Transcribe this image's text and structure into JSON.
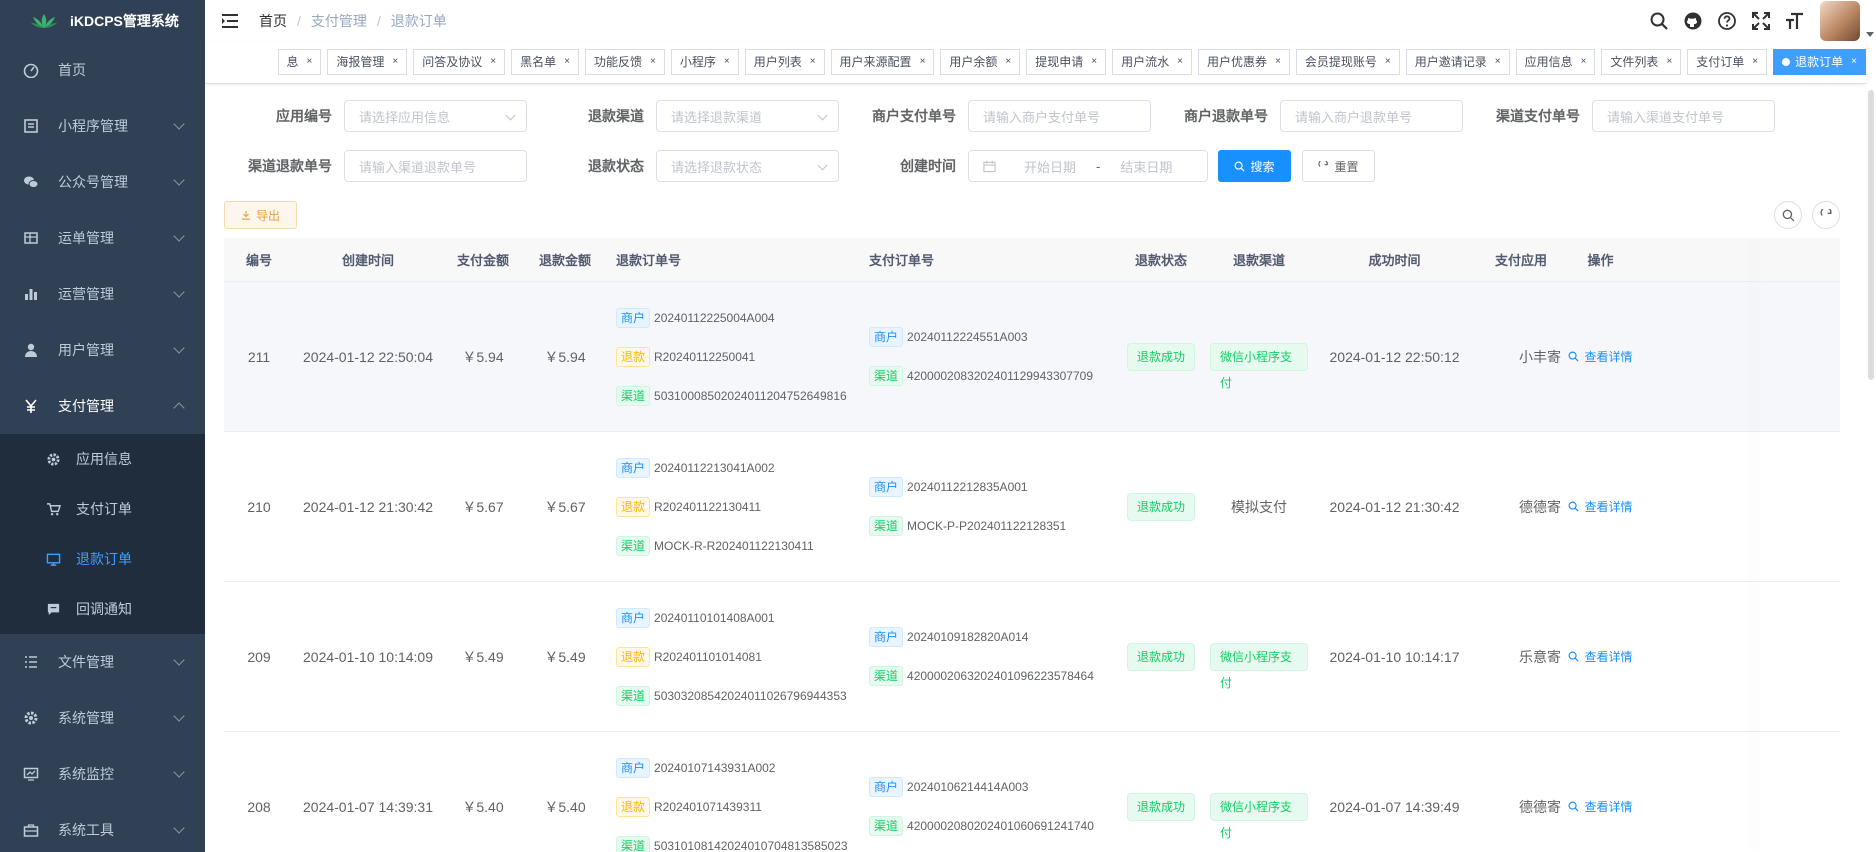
{
  "app": {
    "title": "iKDCPS管理系统"
  },
  "sidebar": {
    "items": [
      {
        "label": "首页",
        "icon": "dashboard-icon"
      },
      {
        "label": "小程序管理",
        "icon": "miniapp-icon"
      },
      {
        "label": "公众号管理",
        "icon": "wechat-icon"
      },
      {
        "label": "运单管理",
        "icon": "table-icon"
      },
      {
        "label": "运营管理",
        "icon": "chart-icon"
      },
      {
        "label": "用户管理",
        "icon": "user-icon"
      },
      {
        "label": "支付管理",
        "icon": "yuan-icon"
      }
    ],
    "sub": [
      {
        "label": "应用信息",
        "icon": "gear-icon"
      },
      {
        "label": "支付订单",
        "icon": "cart-icon"
      },
      {
        "label": "退款订单",
        "icon": "monitor-icon"
      },
      {
        "label": "回调通知",
        "icon": "message-icon"
      }
    ],
    "bottom": [
      {
        "label": "文件管理",
        "icon": "list-icon"
      },
      {
        "label": "系统管理",
        "icon": "gear-icon"
      },
      {
        "label": "系统监控",
        "icon": "monitor-icon"
      },
      {
        "label": "系统工具",
        "icon": "toolbox-icon"
      }
    ]
  },
  "breadcrumb": {
    "home": "首页",
    "parent": "支付管理",
    "current": "退款订单"
  },
  "tags": [
    "息",
    "海报管理",
    "问答及协议",
    "黑名单",
    "功能反馈",
    "小程序",
    "用户列表",
    "用户来源配置",
    "用户余额",
    "提现申请",
    "用户流水",
    "用户优惠券",
    "会员提现账号",
    "用户邀请记录",
    "应用信息",
    "文件列表",
    "支付订单",
    "退款订单"
  ],
  "filters": {
    "app_no": {
      "label": "应用编号",
      "placeholder": "请选择应用信息"
    },
    "refund_channel": {
      "label": "退款渠道",
      "placeholder": "请选择退款渠道"
    },
    "mch_pay_no": {
      "label": "商户支付单号",
      "placeholder": "请输入商户支付单号"
    },
    "mch_refund_no": {
      "label": "商户退款单号",
      "placeholder": "请输入商户退款单号"
    },
    "channel_pay_no": {
      "label": "渠道支付单号",
      "placeholder": "请输入渠道支付单号"
    },
    "channel_refund_no": {
      "label": "渠道退款单号",
      "placeholder": "请输入渠道退款单号"
    },
    "refund_status": {
      "label": "退款状态",
      "placeholder": "请选择退款状态"
    },
    "created": {
      "label": "创建时间",
      "start": "开始日期",
      "sep": "-",
      "end": "结束日期"
    },
    "search": "搜索",
    "reset": "重置",
    "export": "导出"
  },
  "table": {
    "headers": [
      "编号",
      "创建时间",
      "支付金额",
      "退款金额",
      "退款订单号",
      "支付订单号",
      "退款状态",
      "退款渠道",
      "成功时间",
      "支付应用",
      "操作"
    ],
    "tags": {
      "mch": "商户",
      "refund": "退款",
      "channel": "渠道"
    },
    "action": "查看详情",
    "rows": [
      {
        "id": "211",
        "created": "2024-01-12 22:50:04",
        "pay": "￥5.94",
        "refund": "￥5.94",
        "r_mch": "20240112225004A004",
        "r_refund": "R20240112250041",
        "r_channel": "50310008502024011204752649816",
        "p_mch": "20240112224551A003",
        "p_channel": "4200002083202401129943307709",
        "status": "退款成功",
        "channel": "微信小程序支付",
        "success": "2024-01-12 22:50:12",
        "app": "小丰寄"
      },
      {
        "id": "210",
        "created": "2024-01-12 21:30:42",
        "pay": "￥5.67",
        "refund": "￥5.67",
        "r_mch": "20240112213041A002",
        "r_refund": "R202401122130411",
        "r_channel": "MOCK-R-R202401122130411",
        "p_mch": "20240112212835A001",
        "p_channel": "MOCK-P-P202401122128351",
        "status": "退款成功",
        "channel": "模拟支付",
        "success": "2024-01-12 21:30:42",
        "app": "德德寄"
      },
      {
        "id": "209",
        "created": "2024-01-10 10:14:09",
        "pay": "￥5.49",
        "refund": "￥5.49",
        "r_mch": "20240110101408A001",
        "r_refund": "R202401101014081",
        "r_channel": "50303208542024011026796944353",
        "p_mch": "20240109182820A014",
        "p_channel": "4200002063202401096223578464",
        "status": "退款成功",
        "channel": "微信小程序支付",
        "success": "2024-01-10 10:14:17",
        "app": "乐意寄"
      },
      {
        "id": "208",
        "created": "2024-01-07 14:39:31",
        "pay": "￥5.40",
        "refund": "￥5.40",
        "r_mch": "20240107143931A002",
        "r_refund": "R202401071439311",
        "r_channel": "50310108142024010704813585023",
        "p_mch": "20240106214414A003",
        "p_channel": "4200002080202401060691241740",
        "status": "退款成功",
        "channel": "微信小程序支付",
        "success": "2024-01-07 14:39:49",
        "app": "德德寄"
      }
    ]
  }
}
